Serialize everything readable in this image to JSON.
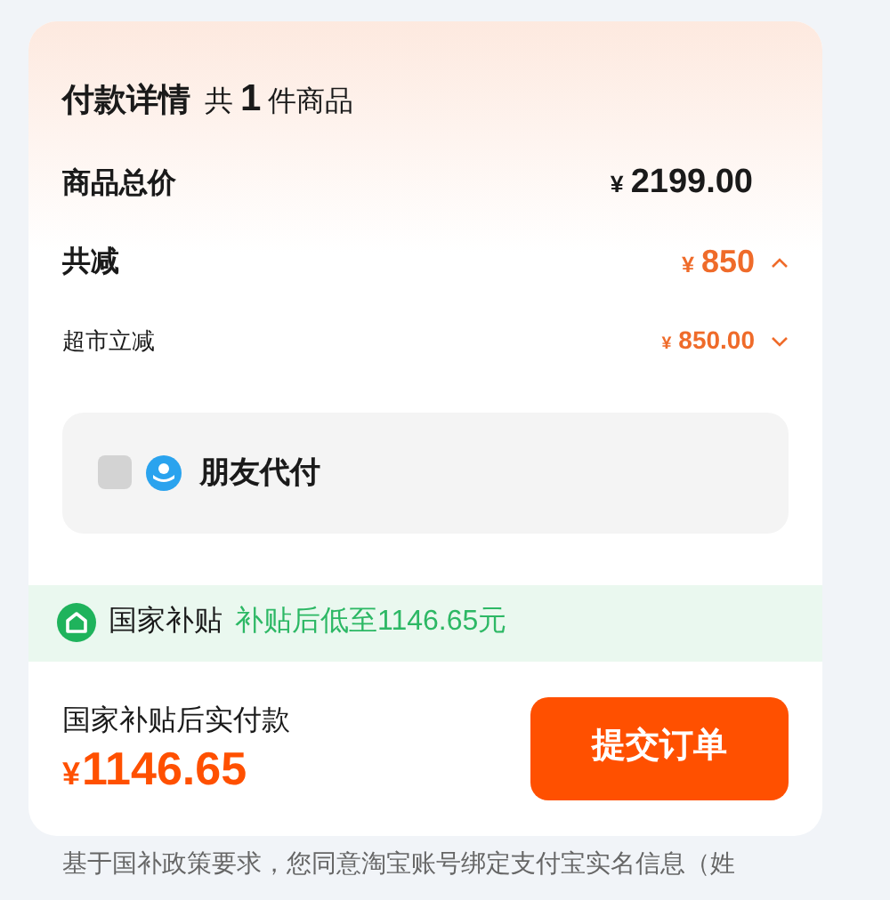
{
  "header": {
    "title": "付款详情",
    "count_prefix": "共",
    "count": "1",
    "count_suffix": "件商品"
  },
  "rows": [
    {
      "kind": "total",
      "label": "商品总价",
      "currency": "¥",
      "amount": "2199.00"
    },
    {
      "kind": "discount",
      "label": "共减",
      "currency": "¥",
      "amount": "850",
      "expanded": true
    },
    {
      "kind": "sub",
      "label": "超市立减",
      "currency": "¥",
      "amount": "850.00",
      "expanded": false
    }
  ],
  "friend_pay": {
    "label": "朋友代付",
    "checked": false
  },
  "subsidy": {
    "label": "国家补贴",
    "note": "补贴后低至1146.65元"
  },
  "footer": {
    "pay_label": "国家补贴后实付款",
    "currency": "¥",
    "amount": "1146.65",
    "submit": "提交订单"
  },
  "notice": "基于国补政策要求，您同意淘宝账号绑定支付宝实名信息（姓"
}
